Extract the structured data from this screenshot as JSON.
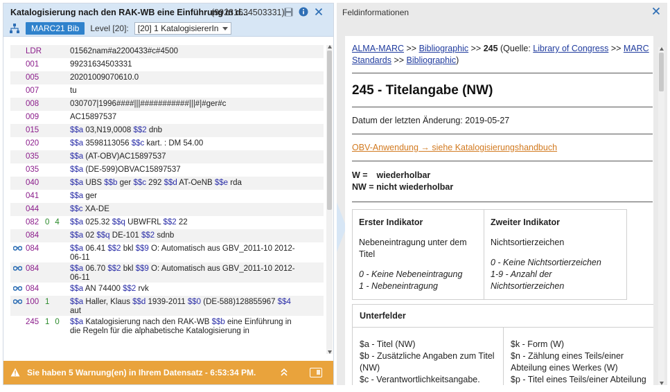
{
  "left": {
    "title": "Katalogisierung nach den RAK-WB eine Einführung in d...",
    "record_id": "(99231634503331)",
    "badge": "MARC21 Bib",
    "level_label": "Level [20]:",
    "level_value": "[20] 1 KatalogisiererIn",
    "rows": [
      {
        "eye": false,
        "tag": "LDR",
        "ind1": "",
        "ind2": "",
        "parts": [
          [
            "t",
            "01562nam#a2200433#c#4500"
          ]
        ]
      },
      {
        "eye": false,
        "tag": "001",
        "ind1": "",
        "ind2": "",
        "parts": [
          [
            "t",
            "99231634503331"
          ]
        ]
      },
      {
        "eye": false,
        "tag": "005",
        "ind1": "",
        "ind2": "",
        "parts": [
          [
            "t",
            "20201009070610.0"
          ]
        ]
      },
      {
        "eye": false,
        "tag": "007",
        "ind1": "",
        "ind2": "",
        "parts": [
          [
            "t",
            "tu"
          ]
        ]
      },
      {
        "eye": false,
        "tag": "008",
        "ind1": "",
        "ind2": "",
        "parts": [
          [
            "t",
            "030707|1996####|||###########|||#|#ger#c"
          ]
        ]
      },
      {
        "eye": false,
        "tag": "009",
        "ind1": "",
        "ind2": "",
        "parts": [
          [
            "t",
            "AC15897537"
          ]
        ]
      },
      {
        "eye": false,
        "tag": "015",
        "ind1": "",
        "ind2": "",
        "parts": [
          [
            "s",
            "$$a"
          ],
          [
            "t",
            " 03,N19,0008 "
          ],
          [
            "s",
            "$$2"
          ],
          [
            "t",
            " dnb"
          ]
        ]
      },
      {
        "eye": false,
        "tag": "020",
        "ind1": "",
        "ind2": "",
        "parts": [
          [
            "s",
            "$$a"
          ],
          [
            "t",
            " 3598113056 "
          ],
          [
            "s",
            "$$c"
          ],
          [
            "t",
            " kart. : DM 54.00"
          ]
        ]
      },
      {
        "eye": false,
        "tag": "035",
        "ind1": "",
        "ind2": "",
        "parts": [
          [
            "s",
            "$$a"
          ],
          [
            "t",
            " (AT-OBV)AC15897537"
          ]
        ]
      },
      {
        "eye": false,
        "tag": "035",
        "ind1": "",
        "ind2": "",
        "parts": [
          [
            "s",
            "$$a"
          ],
          [
            "t",
            " (DE-599)OBVAC15897537"
          ]
        ]
      },
      {
        "eye": false,
        "tag": "040",
        "ind1": "",
        "ind2": "",
        "parts": [
          [
            "s",
            "$$a"
          ],
          [
            "t",
            " UBS "
          ],
          [
            "s",
            "$$b"
          ],
          [
            "t",
            " ger "
          ],
          [
            "s",
            "$$c"
          ],
          [
            "t",
            " 292 "
          ],
          [
            "s",
            "$$d"
          ],
          [
            "t",
            " AT-OeNB "
          ],
          [
            "s",
            "$$e"
          ],
          [
            "t",
            " rda"
          ]
        ]
      },
      {
        "eye": false,
        "tag": "041",
        "ind1": "",
        "ind2": "",
        "parts": [
          [
            "s",
            "$$a"
          ],
          [
            "t",
            " ger"
          ]
        ]
      },
      {
        "eye": false,
        "tag": "044",
        "ind1": "",
        "ind2": "",
        "parts": [
          [
            "s",
            "$$c"
          ],
          [
            "t",
            " XA-DE"
          ]
        ]
      },
      {
        "eye": false,
        "tag": "082",
        "ind1": "0",
        "ind2": "4",
        "parts": [
          [
            "s",
            "$$a"
          ],
          [
            "t",
            " 025.32 "
          ],
          [
            "s",
            "$$q"
          ],
          [
            "t",
            " UBWFRL "
          ],
          [
            "s",
            "$$2"
          ],
          [
            "t",
            " 22"
          ]
        ]
      },
      {
        "eye": false,
        "tag": "084",
        "ind1": "",
        "ind2": "",
        "parts": [
          [
            "s",
            "$$a"
          ],
          [
            "t",
            " 02 "
          ],
          [
            "s",
            "$$q"
          ],
          [
            "t",
            " DE-101 "
          ],
          [
            "s",
            "$$2"
          ],
          [
            "t",
            " sdnb"
          ]
        ]
      },
      {
        "eye": true,
        "tag": "084",
        "ind1": "",
        "ind2": "",
        "parts": [
          [
            "s",
            "$$a"
          ],
          [
            "t",
            " 06.41 "
          ],
          [
            "s",
            "$$2"
          ],
          [
            "t",
            " bkl "
          ],
          [
            "s",
            "$$9"
          ],
          [
            "t",
            " O: Automatisch aus GBV_2011-10 2012-06-11"
          ]
        ]
      },
      {
        "eye": true,
        "tag": "084",
        "ind1": "",
        "ind2": "",
        "parts": [
          [
            "s",
            "$$a"
          ],
          [
            "t",
            " 06.70 "
          ],
          [
            "s",
            "$$2"
          ],
          [
            "t",
            " bkl "
          ],
          [
            "s",
            "$$9"
          ],
          [
            "t",
            " O: Automatisch aus GBV_2011-10 2012-06-11"
          ]
        ]
      },
      {
        "eye": true,
        "tag": "084",
        "ind1": "",
        "ind2": "",
        "parts": [
          [
            "s",
            "$$a"
          ],
          [
            "t",
            " AN 74400 "
          ],
          [
            "s",
            "$$2"
          ],
          [
            "t",
            " rvk"
          ]
        ]
      },
      {
        "eye": true,
        "tag": "100",
        "ind1": "1",
        "ind2": "",
        "parts": [
          [
            "s",
            "$$a"
          ],
          [
            "t",
            " Haller, Klaus "
          ],
          [
            "s",
            "$$d"
          ],
          [
            "t",
            " 1939-2011 "
          ],
          [
            "s",
            "$$0"
          ],
          [
            "t",
            " (DE-588)128855967 "
          ],
          [
            "s",
            "$$4"
          ],
          [
            "t",
            " aut"
          ]
        ]
      },
      {
        "eye": false,
        "tag": "245",
        "ind1": "1",
        "ind2": "0",
        "parts": [
          [
            "s",
            "$$a"
          ],
          [
            "t",
            " Katalogisierung nach den RAK-WB "
          ],
          [
            "s",
            "$$b"
          ],
          [
            "t",
            " eine Einführung in die Regeln für die alphabetische Katalogisierung in"
          ]
        ]
      }
    ],
    "warning": "Sie haben 5 Warnung(en) in Ihrem Datensatz - 6:53:34 PM."
  },
  "right": {
    "title": "Feldinformationen",
    "crumb": {
      "alma": "ALMA-MARC",
      "sep": " >> ",
      "bib1": "Bibliographic",
      "field": "245",
      "source_pre": " (Quelle: ",
      "loc": "Library of Congress",
      "marc": "MARC Standards",
      "bib2": "Bibliographic",
      "close": ")"
    },
    "heading": "245 - Titelangabe (NW)",
    "date": "Datum der letzten Änderung: 2019-05-27",
    "obv_link": "OBV-Anwendung → siehe Katalogisierungshandbuch",
    "legend_w_key": "W =",
    "legend_w_val": "wiederholbar",
    "legend_nw": "NW = nicht wiederholbar",
    "ind1": {
      "head": "Erster Indikator",
      "desc": "Nebeneintragung unter dem Titel",
      "v1": "0 - Keine Nebeneintragung",
      "v2": "1 - Nebeneintragung"
    },
    "ind2": {
      "head": "Zweiter Indikator",
      "desc": "Nichtsortierzeichen",
      "v1": "0 - Keine Nichtsortierzeichen",
      "v2": "1-9 - Anzahl der Nichtsortierzeichen"
    },
    "subfields": {
      "head": "Unterfelder",
      "col1": [
        "$a - Titel (NW)",
        "$b - Zusätzliche Angaben zum Titel (NW)",
        "$c - Verantwortlichkeitsangabe."
      ],
      "col2": [
        "$k - Form (W)",
        "$n - Zählung eines Teils/einer Abteilung eines Werkes (W)",
        "$p - Titel eines Teils/einer Abteilung"
      ]
    }
  },
  "colors": {
    "accent": "#2f82cc",
    "warning": "#e9a33c",
    "tag": "#8b1c8b",
    "subfield": "#2b2fa8",
    "indicator": "#2a8a2a"
  }
}
